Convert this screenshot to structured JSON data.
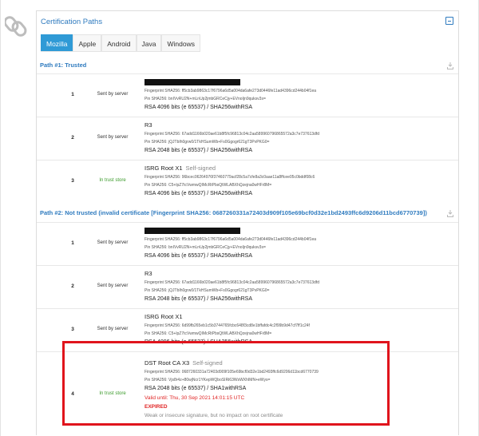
{
  "section_title": "Certification Paths",
  "tabs": [
    "Mozilla",
    "Apple",
    "Android",
    "Java",
    "Windows"
  ],
  "active_tab": "Mozilla",
  "path1": {
    "title": "Path #1: Trusted",
    "rows": [
      {
        "num": "1",
        "source": "Sent by server",
        "fp": "Fingerprint SHA256: ff5cb3ab9863c17f6796a6d5a004da6afe273d0446fe11ad4396cd244b04f1ea",
        "pin": "Pin SHA256: bnIVvRU2N+mLnUp2jmbGRCeCjy+EVnoIjn9quksv3s=",
        "key": "RSA 4096 bits (e 65537) / SHA256withRSA"
      },
      {
        "num": "2",
        "source": "Sent by server",
        "name": "R3",
        "fp": "Fingerprint SHA256: 67add1166b020ae61b8f5fc96813c04c2aa589960796865572a3c7e737613dfd",
        "pin": "Pin SHA256: jQJTbIh0grw0/1TkHSumWb+Fs0Ggogr621gT3PvPKG0=",
        "key": "RSA 2048 bits (e 65537) / SHA256withRSA"
      },
      {
        "num": "3",
        "source": "In trust store",
        "name": "ISRG Root X1",
        "tag": "Self-signed",
        "fp": "Fingerprint SHA256: 96bcec06264976f37460779acf28c5a7cfe8a3c0aae11a8ffcee05c0bddf08c6",
        "pin": "Pin SHA256: C5+lpZ7tcVwmwQIMcRtPbsQtWLABXhQzejna0wHFr8M=",
        "key": "RSA 4096 bits (e 65537) / SHA256withRSA"
      }
    ]
  },
  "path2": {
    "title": "Path #2: Not trusted (invalid certificate [Fingerprint SHA256: 0687260331a72403d909f105e69bcf0d32e1bd2493ffc6d9206d11bcd6770739])",
    "rows": [
      {
        "num": "1",
        "source": "Sent by server",
        "fp": "Fingerprint SHA256: ff5cb3ab9863c17f6796a6d5a004da6afe273d0446fe11ad4396cd244b04f1ea",
        "pin": "Pin SHA256: bnIVvRU2N+mLnUp2jmbGRCeCjy+EVnoIjn9quksv3s=",
        "key": "RSA 4096 bits (e 65537) / SHA256withRSA"
      },
      {
        "num": "2",
        "source": "Sent by server",
        "name": "R3",
        "fp": "Fingerprint SHA256: 67add1166b020ae61b8f5fc96813c04c2aa589960796865572a3c7e737613dfd",
        "pin": "Pin SHA256: jQJTbIh0grw0/1TkHSumWb+Fs0Ggogr621gT3PvPKG0=",
        "key": "RSA 2048 bits (e 65537) / SHA256withRSA"
      },
      {
        "num": "3",
        "source": "Sent by server",
        "name": "ISRG Root X1",
        "fp": "Fingerprint SHA256: 6d99fb265eb1c5b3744765fcbc648f3cd8e1bffafdc4c2f99b9d47cf7ff1c24f",
        "pin": "Pin SHA256: C5+lpZ7tcVwmwQIMcRtPbsQtWLABXhQzejna0wHFr8M=",
        "key": "RSA 4096 bits (e 65537) / SHA256withRSA"
      },
      {
        "num": "4",
        "source": "In trust store",
        "name": "DST Root CA X3",
        "tag": "Self-signed",
        "fp": "Fingerprint SHA256: 0687260331a72403d909f105e69bcf0d32e1bd2493ffc6d9206d11bcd6770739",
        "pin": "Pin SHA256: Vjs8r4z+80wjNcr1YKepWQboSIRi63WsWXhIMN+eWys=",
        "key": "RSA 2048 bits (e 65537) / SHA1withRSA",
        "valid_until": "Valid until: Thu, 30 Sep 2021 14:01:15 UTC",
        "status": "EXPIRED",
        "note": "Weak or insecure signature, but no impact on root certificate"
      }
    ]
  },
  "colors": {
    "accent": "#2f7bbf",
    "tab_active": "#2f9ad6",
    "error": "#e02424",
    "trust": "#3a9a2a"
  }
}
